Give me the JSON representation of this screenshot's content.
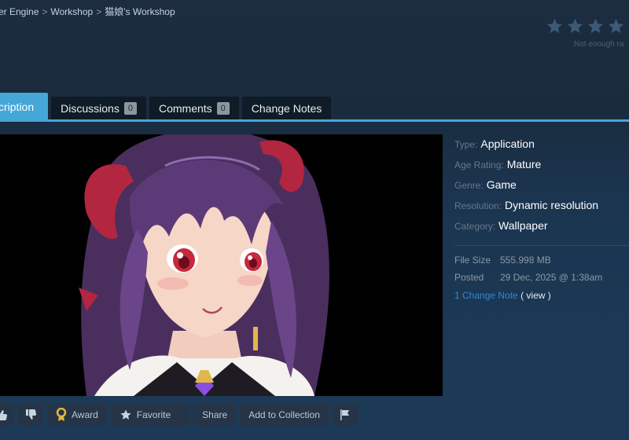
{
  "breadcrumb": {
    "items": [
      "er Engine",
      "Workshop",
      "猫娘's Workshop"
    ],
    "separator": ">"
  },
  "rating": {
    "stars": 4,
    "text": "Not enough ra"
  },
  "tabs": [
    {
      "label": "cription",
      "active": true
    },
    {
      "label": "Discussions",
      "count": "0"
    },
    {
      "label": "Comments",
      "count": "0"
    },
    {
      "label": "Change Notes"
    }
  ],
  "details": [
    {
      "key": "Type:",
      "value": "Application"
    },
    {
      "key": "Age Rating:",
      "value": "Mature"
    },
    {
      "key": "Genre:",
      "value": "Game"
    },
    {
      "key": "Resolution:",
      "value": "Dynamic resolution"
    },
    {
      "key": "Category:",
      "value": "Wallpaper"
    }
  ],
  "stats": [
    {
      "key": "File Size",
      "value": "555.998 MB"
    },
    {
      "key": "Posted",
      "value": "29 Dec, 2025 @ 1:38am"
    }
  ],
  "change_note": {
    "link": "1 Change Note",
    "view": "( view )"
  },
  "actions": {
    "award": "Award",
    "favorite": "Favorite",
    "share": "Share",
    "add_to_collection": "Add to Collection"
  },
  "colors": {
    "accent": "#45a6d8",
    "link": "#2d8ad4",
    "award_gold": "#e8b83a"
  },
  "icons": [
    "thumb-up-icon",
    "thumb-down-icon",
    "award-icon",
    "star-icon",
    "flag-icon"
  ]
}
